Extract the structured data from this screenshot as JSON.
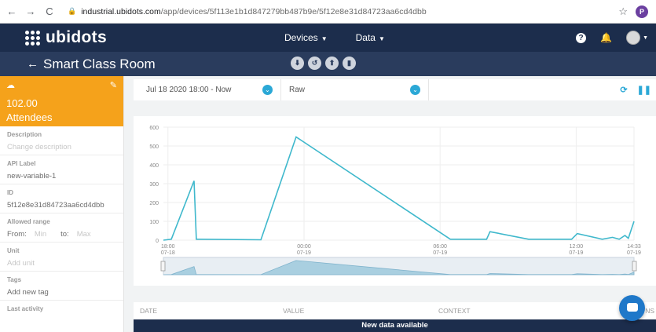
{
  "browser": {
    "url_domain": "industrial.ubidots.com",
    "url_path": "/app/devices/5f113e1b1d847279bb487b9e/5f12e8e31d84723aa6cd4dbb",
    "profile_initial": "P"
  },
  "topnav": {
    "logo": "ubidots",
    "menu_devices": "Devices",
    "menu_data": "Data"
  },
  "subheader": {
    "title": "Smart Class Room"
  },
  "variable": {
    "value": "102.00",
    "name": "Attendees"
  },
  "fields": {
    "description_label": "Description",
    "description_value": "Change description",
    "api_label_label": "API Label",
    "api_label_value": "new-variable-1",
    "id_label": "ID",
    "id_value": "5f12e8e31d84723aa6cd4dbb",
    "range_label": "Allowed range",
    "range_from": "From:",
    "range_min": "Min",
    "range_to": "to:",
    "range_max": "Max",
    "unit_label": "Unit",
    "unit_value": "Add unit",
    "tags_label": "Tags",
    "tags_value": "Add new tag",
    "last_activity_label": "Last activity"
  },
  "toolbar": {
    "date_range": "Jul 18 2020 18:00 - Now",
    "aggregation": "Raw"
  },
  "table": {
    "col_date": "DATE",
    "col_value": "VALUE",
    "col_context": "CONTEXT",
    "col_actions": "NS"
  },
  "banner": "New data available",
  "colors": {
    "nav": "#1c2d4c",
    "subnav": "#2a3c5d",
    "variable_card": "#f5a21b",
    "line": "#3fb8cc",
    "accent": "#2ba8d6"
  },
  "chart_data": {
    "type": "line",
    "ylim": [
      0,
      600
    ],
    "y_ticks": [
      "0",
      "100",
      "200",
      "300",
      "400",
      "500",
      "600"
    ],
    "x_ticks": [
      {
        "time": "18:00",
        "date": "07-18",
        "h": 0
      },
      {
        "time": "00:00",
        "date": "07-19",
        "h": 6
      },
      {
        "time": "06:00",
        "date": "07-19",
        "h": 12
      },
      {
        "time": "12:00",
        "date": "07-19",
        "h": 18
      },
      {
        "time": "14:33",
        "date": "07-19",
        "h": 20.55
      }
    ],
    "xlim_h": [
      -0.2,
      20.55
    ],
    "points_h": [
      [
        -0.2,
        0
      ],
      [
        0.15,
        5
      ],
      [
        1.15,
        315
      ],
      [
        1.25,
        5
      ],
      [
        4.1,
        2
      ],
      [
        5.65,
        548
      ],
      [
        12.45,
        5
      ],
      [
        14.05,
        5
      ],
      [
        14.2,
        45
      ],
      [
        15.9,
        5
      ],
      [
        17.8,
        5
      ],
      [
        18.05,
        35
      ],
      [
        19.15,
        5
      ],
      [
        19.6,
        15
      ],
      [
        19.9,
        5
      ],
      [
        20.15,
        25
      ],
      [
        20.3,
        10
      ],
      [
        20.55,
        100
      ]
    ]
  }
}
